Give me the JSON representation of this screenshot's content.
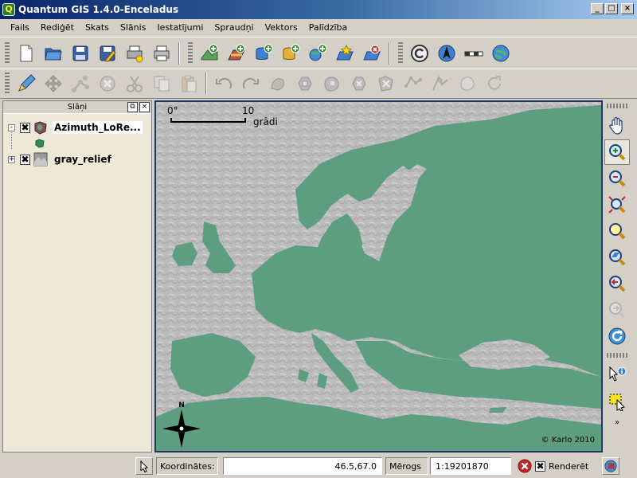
{
  "window": {
    "title": "Quantum GIS 1.4.0-Enceladus",
    "controls": [
      "_",
      "□",
      "×"
    ]
  },
  "menu": [
    "Fails",
    "Rediģēt",
    "Skats",
    "Slānis",
    "Iestatījumi",
    "Spraudņi",
    "Vektors",
    "Palīdzība"
  ],
  "toolbar1": {
    "buttons": [
      "new-project-icon",
      "open-project-icon",
      "save-project-icon",
      "save-as-icon",
      "print-composer-icon",
      "print-icon",
      "add-vector-layer-icon",
      "add-raster-layer-icon",
      "add-postgis-layer-icon",
      "add-spatialite-layer-icon",
      "add-wms-layer-icon",
      "new-vector-layer-icon",
      "remove-layer-icon",
      "copyright-label-icon",
      "north-arrow-icon",
      "scale-bar-icon",
      "globe-icon"
    ]
  },
  "toolbar2": {
    "buttons": [
      "edit-pencil-icon",
      "move-feature-icon",
      "node-tool-icon",
      "delete-selected-icon",
      "cut-features-icon",
      "copy-features-icon",
      "paste-features-icon",
      "undo-icon",
      "redo-icon",
      "simplify-feature-icon",
      "add-ring-icon",
      "add-island-icon",
      "delete-ring-icon",
      "delete-part-icon",
      "reshape-features-icon",
      "split-features-icon",
      "merge-features-icon",
      "rotate-labels-icon"
    ]
  },
  "layers_panel": {
    "title": "Slāņi",
    "layers": [
      {
        "name": "Azimuth_LoRe...",
        "checked": "✖",
        "expanded": "-",
        "legend_color": "#2e8b57"
      },
      {
        "name": "gray_relief",
        "checked": "✖",
        "expanded": "+"
      }
    ]
  },
  "map": {
    "scale_zero": "0°",
    "scale_ten": "10",
    "scale_unit": "grādi",
    "copyright": "© Karlo 2010",
    "north_label": "N",
    "land_color": "#5e9e80",
    "sea_color": "#bdbdbd"
  },
  "right_tools": [
    "pan-icon",
    "zoom-in-icon",
    "zoom-out-icon",
    "zoom-full-icon",
    "zoom-to-selection-icon",
    "zoom-to-layer-icon",
    "zoom-last-icon",
    "zoom-next-icon",
    "refresh-icon",
    "identify-icon",
    "select-features-icon"
  ],
  "statusbar": {
    "coords_label": "Koordinātes:",
    "coords_value": "46.5,67.0",
    "scale_label": "Mērogs",
    "scale_value": "1:19201870",
    "render_label": "Renderēt",
    "render_check": "✖"
  }
}
